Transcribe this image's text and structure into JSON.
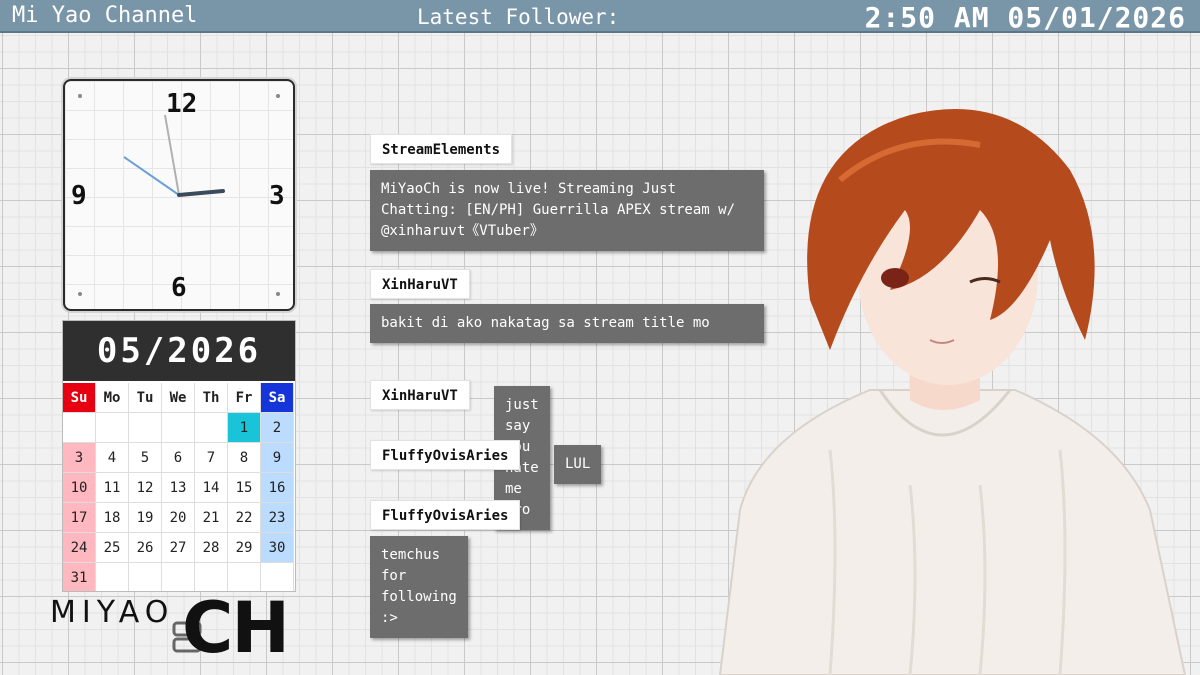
{
  "header": {
    "channel": "Mi Yao Channel",
    "latest_follower_label": "Latest Follower:",
    "datetime": "2:50 AM 05/01/2026"
  },
  "clock": {
    "numerals": {
      "twelve": "12",
      "three": "3",
      "six": "6",
      "nine": "9"
    },
    "time": {
      "hour": 2,
      "minute": 50
    }
  },
  "calendar": {
    "month_label": "05/2026",
    "weekdays": [
      "Su",
      "Mo",
      "Tu",
      "We",
      "Th",
      "Fr",
      "Sa"
    ],
    "weeks": [
      [
        "",
        "",
        "",
        "",
        "",
        "1",
        "2"
      ],
      [
        "3",
        "4",
        "5",
        "6",
        "7",
        "8",
        "9"
      ],
      [
        "10",
        "11",
        "12",
        "13",
        "14",
        "15",
        "16"
      ],
      [
        "17",
        "18",
        "19",
        "20",
        "21",
        "22",
        "23"
      ],
      [
        "24",
        "25",
        "26",
        "27",
        "28",
        "29",
        "30"
      ],
      [
        "31",
        "",
        "",
        "",
        "",
        "",
        ""
      ]
    ],
    "today": "1"
  },
  "logo": {
    "line1": "MIYAO",
    "line2": "CH"
  },
  "chat": [
    {
      "user": "StreamElements",
      "text": "MiYaoCh is now live! Streaming Just Chatting: [EN/PH] Guerrilla APEX stream w/ @xinharuvt《VTuber》"
    },
    {
      "user": "XinHaruVT",
      "text": "bakit di ako nakatag sa stream title mo"
    },
    {
      "user": "XinHaruVT",
      "text": "just say you hate me bro"
    },
    {
      "user": "FluffyOvisAries",
      "text": "LUL"
    },
    {
      "user": "FluffyOvisAries",
      "text": "temchus for following :>"
    }
  ],
  "colors": {
    "header_bar": "#7995a8",
    "chat_bubble": "#6d6d6d",
    "sunday_header": "#e60012",
    "saturday_header": "#1535d9",
    "today_highlight": "#19c4d8"
  }
}
